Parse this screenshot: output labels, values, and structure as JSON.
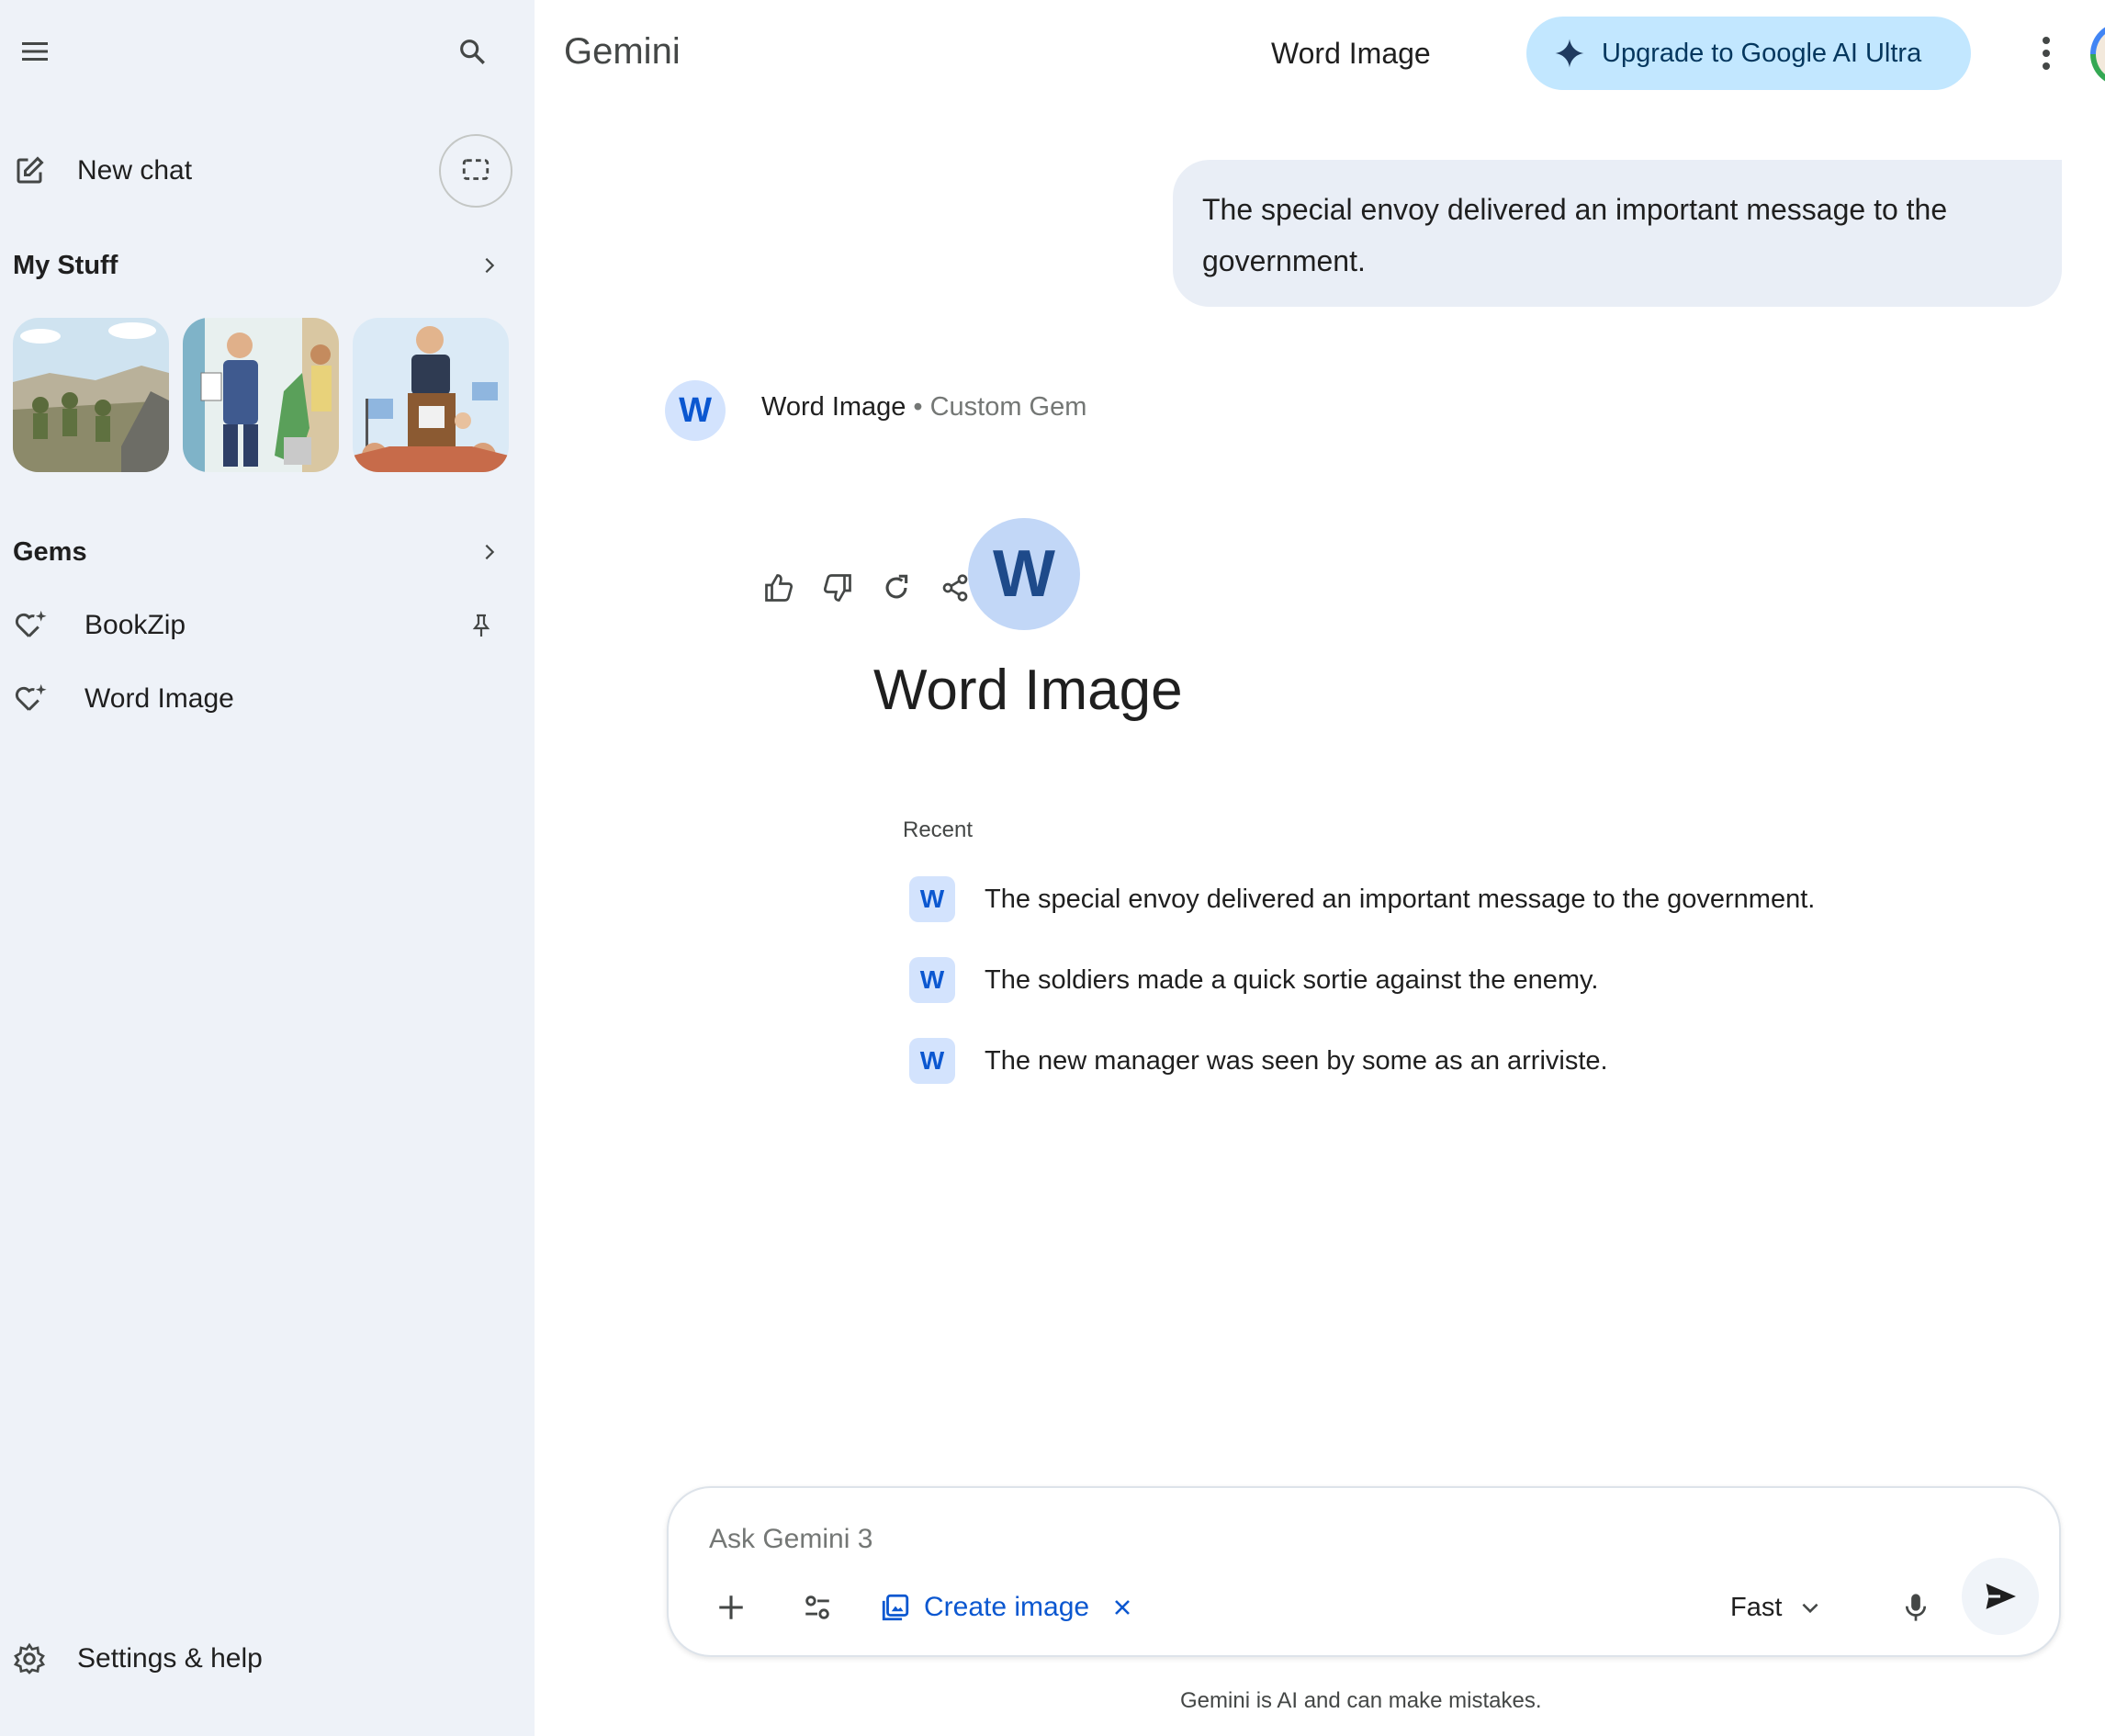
{
  "sidebar": {
    "new_chat": "New chat",
    "my_stuff": "My Stuff",
    "gems_title": "Gems",
    "gems": [
      {
        "label": "BookZip",
        "pinned": true
      },
      {
        "label": "Word Image",
        "pinned": false
      }
    ],
    "settings": "Settings & help"
  },
  "header": {
    "brand": "Gemini",
    "chat_title": "Word Image",
    "upgrade": "Upgrade to Google AI Ultra"
  },
  "conversation": {
    "user_message": "The special envoy delivered an important message to the government."
  },
  "gem": {
    "initial": "W",
    "name": "Word Image",
    "separator": "•",
    "type": "Custom Gem",
    "recent_label": "Recent",
    "recent": [
      "The special envoy delivered an important message to the government.",
      "The soldiers made a quick sortie against the enemy.",
      "The new manager was seen by some as an arriviste."
    ]
  },
  "input": {
    "placeholder": "Ask Gemini 3",
    "create_image": "Create image",
    "model": "Fast",
    "disclaimer": "Gemini is AI and can make mistakes."
  },
  "colors": {
    "sidebar_bg": "#eef2f8",
    "accent": "#0b57d0",
    "upgrade_bg": "#c2e7ff",
    "bubble_bg": "#e9eef6"
  }
}
